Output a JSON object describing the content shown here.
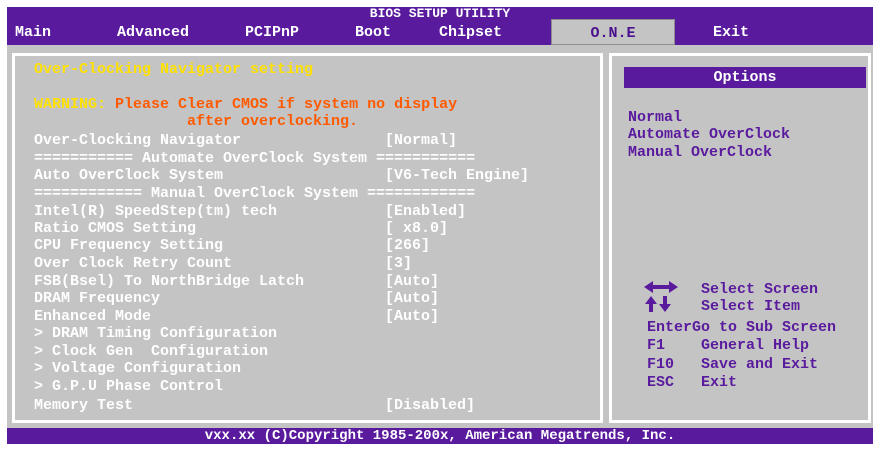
{
  "title": "BIOS SETUP UTILITY",
  "menu": [
    "Main",
    "Advanced",
    "PCIPnP",
    "Boot",
    "Chipset",
    "O.N.E",
    "Exit"
  ],
  "active_menu": "O.N.E",
  "section_title": "Over-Clocking Navigator setting",
  "warning": {
    "prefix": "WARNING:",
    "line1": "Please Clear CMOS if system no display",
    "line2": "after overclocking."
  },
  "settings": [
    {
      "label": "Over-Clocking Navigator",
      "value": "[Normal]"
    },
    {
      "label": "=========== Automate OverClock System ===========",
      "value": ""
    },
    {
      "label": "Auto OverClock System",
      "value": "[V6-Tech Engine]"
    },
    {
      "label": "============ Manual OverClock System ============",
      "value": ""
    },
    {
      "label": "Intel(R) SpeedStep(tm) tech",
      "value": "[Enabled]"
    },
    {
      "label": "Ratio CMOS Setting",
      "value": "[ x8.0]"
    },
    {
      "label": "CPU Frequency Setting",
      "value": "[266]"
    },
    {
      "label": "Over Clock Retry Count",
      "value": "[3]"
    },
    {
      "label": "FSB(Bsel) To NorthBridge Latch",
      "value": "[Auto]"
    },
    {
      "label": "DRAM Frequency",
      "value": "[Auto]"
    },
    {
      "label": "Enhanced Mode",
      "value": "[Auto]"
    },
    {
      "label": "> DRAM Timing Configuration",
      "value": ""
    },
    {
      "label": "> Clock Gen  Configuration",
      "value": ""
    },
    {
      "label": "> Voltage Configuration",
      "value": ""
    },
    {
      "label": "> G.P.U Phase Control",
      "value": ""
    },
    {
      "label": "Memory Test",
      "value": "[Disabled]"
    }
  ],
  "options_header": "Options",
  "options": [
    "Normal",
    "Automate OverClock",
    "Manual OverClock"
  ],
  "help": [
    {
      "key": "",
      "text": "Select Screen",
      "icon": "left-right-arrows-icon"
    },
    {
      "key": "",
      "text": "Select Item",
      "icon": "up-down-arrows-icon"
    },
    {
      "key": "Enter",
      "text": "Go to Sub Screen"
    },
    {
      "key": "F1",
      "text": "General Help"
    },
    {
      "key": "F10",
      "text": "Save and Exit"
    },
    {
      "key": "ESC",
      "text": "Exit"
    }
  ],
  "footer": "vxx.xx (C)Copyright 1985-200x, American Megatrends, Inc.",
  "colors": {
    "accent": "#5a1a9e",
    "background": "#c4c4c4",
    "highlight": "#ffe100",
    "warning": "#ff5a00"
  }
}
